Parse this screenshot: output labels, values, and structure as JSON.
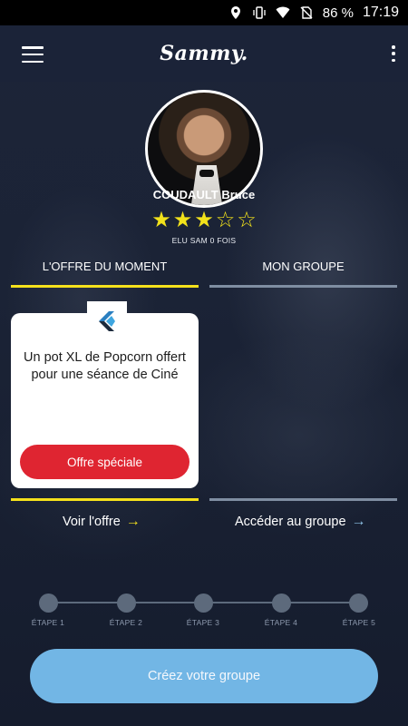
{
  "status_bar": {
    "battery": "86 %",
    "time": "17:19",
    "icons": [
      "location-icon",
      "vibrate-icon",
      "wifi-icon",
      "no-sim-icon"
    ]
  },
  "app_bar": {
    "title": "Sammy.",
    "menu_icon": "hamburger-menu-icon",
    "more_icon": "more-vertical-icon"
  },
  "profile": {
    "name": "COUDAULT Bruce",
    "rating": 3,
    "max_rating": 5,
    "elected_text": "ELU SAM 0 FOIS",
    "star_full": "★",
    "star_empty": "☆"
  },
  "tabs": [
    {
      "label": "L'OFFRE DU MOMENT",
      "active": true
    },
    {
      "label": "MON GROUPE",
      "active": false
    }
  ],
  "offer_card": {
    "description": "Un pot XL de Popcorn offert pour une séance de Ciné",
    "button_label": "Offre spéciale"
  },
  "links": {
    "view_offer": "Voir l'offre",
    "access_group": "Accéder au groupe",
    "arrow": "→"
  },
  "steps": [
    "ÉTAPE 1",
    "ÉTAPE 2",
    "ÉTAPE 3",
    "ÉTAPE 4",
    "ÉTAPE 5"
  ],
  "cta_label": "Créez votre groupe",
  "colors": {
    "accent_yellow": "#f5e11c",
    "accent_blue": "#72b6e5",
    "button_red": "#df2531",
    "background": "#1a2236"
  }
}
